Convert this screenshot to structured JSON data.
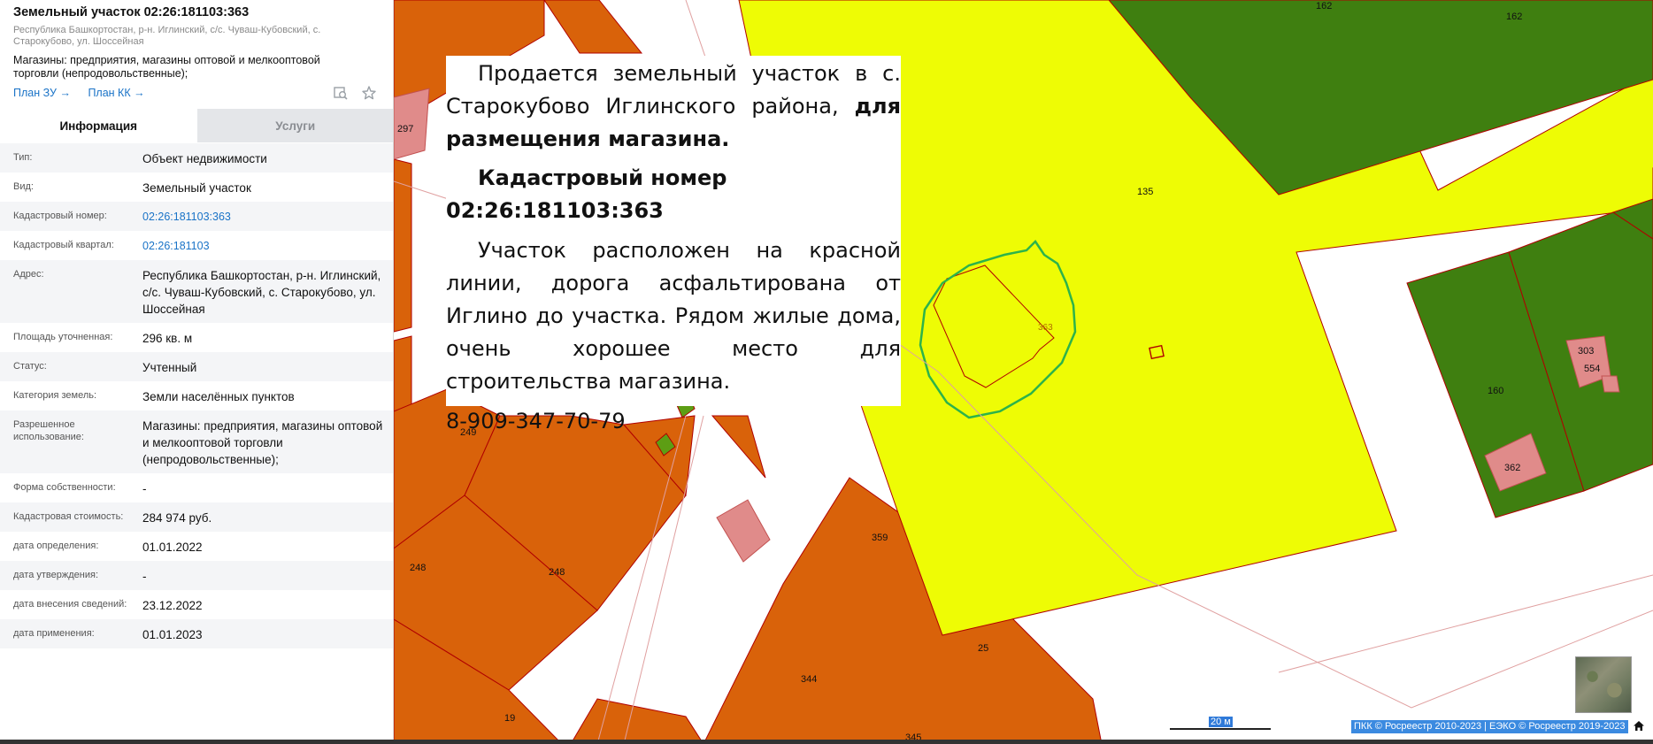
{
  "panel": {
    "title": "Земельный участок 02:26:181103:363",
    "address_short": "Республика Башкортостан, р-н. Иглинский, с/с. Чуваш-Кубовский, с. Старокубово, ул. Шоссейная",
    "use": "Магазины: предприятия, магазины оптовой и мелкооптовой торговли (непродовольственные);",
    "links": [
      "План ЗУ",
      "План КК"
    ],
    "icons": [
      "search-map-icon",
      "star-icon"
    ],
    "tabs": [
      {
        "label": "Информация",
        "active": true
      },
      {
        "label": "Услуги",
        "active": false
      }
    ],
    "rows": [
      {
        "key": "Тип:",
        "value": "Объект недвижимости"
      },
      {
        "key": "Вид:",
        "value": "Земельный участок"
      },
      {
        "key": "Кадастровый номер:",
        "value": "02:26:181103:363",
        "link": true
      },
      {
        "key": "Кадастровый квартал:",
        "value": "02:26:181103",
        "link": true
      },
      {
        "key": "Адрес:",
        "value": "Республика Башкортостан, р-н. Иглинский, с/с. Чуваш-Кубовский, с. Старокубово, ул. Шоссейная"
      },
      {
        "key": "Площадь уточненная:",
        "value": "296 кв. м"
      },
      {
        "key": "Статус:",
        "value": "Учтенный"
      },
      {
        "key": "Категория земель:",
        "value": "Земли населённых пунктов"
      },
      {
        "key": "Разрешенное использование:",
        "value": "Магазины: предприятия, магазины оптовой и мелкооптовой торговли (непродовольственные);"
      },
      {
        "key": "Форма собственности:",
        "value": "-"
      },
      {
        "key": "Кадастровая стоимость:",
        "value": "284 974 руб."
      },
      {
        "key": "дата определения:",
        "value": "01.01.2022"
      },
      {
        "key": "дата утверждения:",
        "value": "-"
      },
      {
        "key": "дата внесения сведений:",
        "value": "23.12.2022"
      },
      {
        "key": "дата применения:",
        "value": "01.01.2023"
      }
    ]
  },
  "ad": {
    "p1_text": "Продается земельный участок в с. Старокубово Иглинского района, ",
    "p1_bold": "для размещения магазина.",
    "heading": "Кадастровый номер 02:26:181103:363",
    "p2": "Участок расположен на красной линии, дорога асфальтирована от Иглино до участка. Рядом жилые дома, очень хорошее место для строительства магазина.",
    "phone": "8-909-347-70-79"
  },
  "map": {
    "parcel_labels": [
      "162",
      "162",
      "297",
      "135",
      "363",
      "303",
      "554",
      "160",
      "362",
      "249",
      "248",
      "248",
      "359",
      "25",
      "344",
      "19",
      "345"
    ],
    "scale_label": "20 м",
    "copyright": "ПКК © Росреестр 2010-2023 | ЕЭКО © Росреестр 2019-2023",
    "colors": {
      "orange": "#d9620a",
      "yellow": "#eefc05",
      "green": "#3f7f10",
      "pink": "#e08b8a",
      "selected_outline": "#2db34a",
      "boundary": "#b00000"
    }
  }
}
